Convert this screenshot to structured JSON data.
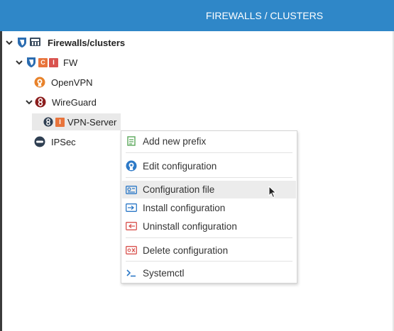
{
  "header": {
    "title": "FIREWALLS / CLUSTERS"
  },
  "tree": {
    "root": {
      "label": "Firewalls/clusters",
      "icon": "firewall-cluster-icon"
    },
    "fw": {
      "label": "FW",
      "badges": [
        "C",
        "I"
      ]
    },
    "openvpn": {
      "label": "OpenVPN",
      "icon": "openvpn-icon"
    },
    "wireguard": {
      "label": "WireGuard",
      "icon": "wireguard-icon"
    },
    "vpn_server": {
      "label": "VPN-Server",
      "badge": "I"
    },
    "ipsec": {
      "label": "IPSec",
      "icon": "ipsec-icon"
    }
  },
  "context_menu": {
    "items": [
      {
        "label": "Add new prefix",
        "icon": "add-prefix-icon"
      },
      {
        "label": "Edit configuration",
        "icon": "openvpn-icon"
      },
      {
        "label": "Configuration file",
        "icon": "config-file-icon"
      },
      {
        "label": "Install configuration",
        "icon": "install-icon"
      },
      {
        "label": "Uninstall configuration",
        "icon": "uninstall-icon"
      },
      {
        "label": "Delete configuration",
        "icon": "delete-icon"
      },
      {
        "label": "Systemctl",
        "icon": "terminal-icon"
      }
    ]
  },
  "colors": {
    "header": "#2f87c8",
    "badge_orange": "#e8743b",
    "badge_red": "#d9534f",
    "shield_blue": "#2b6cb0",
    "wireguard_red": "#8b1d1d",
    "openvpn_orange": "#e8822a",
    "menu_blue": "#2d79c7",
    "menu_red": "#d9534f",
    "menu_green": "#5ba85b"
  }
}
